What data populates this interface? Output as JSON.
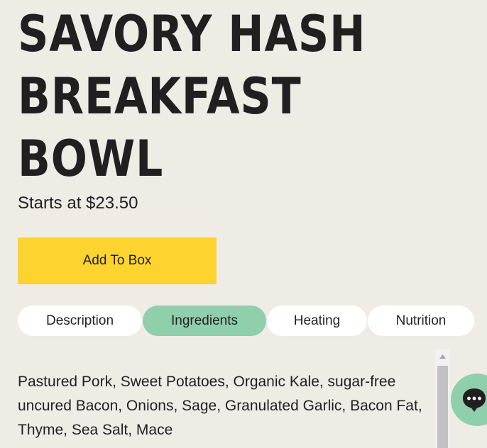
{
  "product": {
    "title_lines": [
      "SAVORY HASH",
      "BREAKFAST",
      "BOWL"
    ],
    "price": "Starts at $23.50",
    "add_button_label": "Add To Box"
  },
  "tabs": [
    {
      "label": "Description",
      "active": false
    },
    {
      "label": "Ingredients",
      "active": true
    },
    {
      "label": "Heating",
      "active": false
    },
    {
      "label": "Nutrition",
      "active": false
    }
  ],
  "ingredients": {
    "text": "Pastured Pork, Sweet Potatoes, Organic Kale, sugar-free uncured Bacon, Onions, Sage, Granulated Garlic, Bacon Fat, Thyme, Sea Salt, Mace"
  },
  "icons": {
    "chat": "chat-bubble-icon",
    "scroll_up": "chevron-up-icon"
  },
  "colors": {
    "background": "#efebe5",
    "button": "#fdd42f",
    "active_tab": "#8fcfac",
    "text": "#231f20",
    "chat_button": "#8fcfac"
  }
}
